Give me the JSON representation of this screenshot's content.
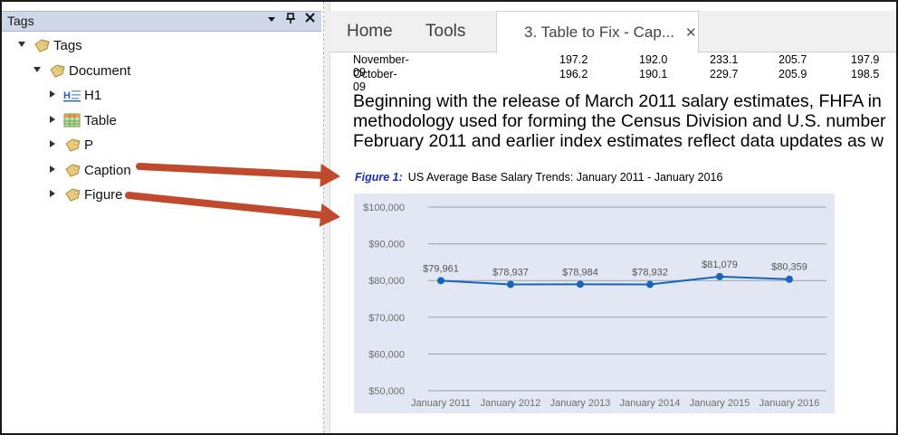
{
  "tags_panel": {
    "title": "Tags",
    "buttons": {
      "menu": "▾",
      "pin": "📌",
      "close": "✕"
    },
    "tree": [
      {
        "label": "Tags",
        "level": 0,
        "expanded": true,
        "icon": "tag-icon"
      },
      {
        "label": "Document",
        "level": 1,
        "expanded": true,
        "icon": "tag-icon"
      },
      {
        "label": "H1",
        "level": 2,
        "expanded": false,
        "icon": "heading-icon"
      },
      {
        "label": "Table",
        "level": 2,
        "expanded": false,
        "icon": "table-icon"
      },
      {
        "label": "P",
        "level": 2,
        "expanded": false,
        "icon": "tag-icon"
      },
      {
        "label": "Caption",
        "level": 2,
        "expanded": false,
        "icon": "tag-icon"
      },
      {
        "label": "Figure",
        "level": 2,
        "expanded": false,
        "icon": "tag-icon"
      }
    ]
  },
  "tabs": {
    "home": "Home",
    "tools": "Tools",
    "document": "3. Table to Fix - Cap...",
    "close": "✕"
  },
  "table_rows": [
    {
      "label": "November-09",
      "values": [
        "197.2",
        "192.0",
        "233.1",
        "205.7",
        "197.9"
      ]
    },
    {
      "label": "October-09",
      "values": [
        "196.2",
        "190.1",
        "229.7",
        "205.9",
        "198.5"
      ]
    }
  ],
  "paragraph": [
    "Beginning with the release of March 2011 salary estimates, FHFA in",
    "methodology used for forming the Census Division and U.S. number",
    "February 2011 and earlier index estimates reflect data updates as w"
  ],
  "caption": {
    "figure_label": "Figure 1:",
    "text": "US Average Base Salary Trends: January 2011 - January 2016"
  },
  "chart_data": {
    "type": "line",
    "categories": [
      "January 2011",
      "January 2012",
      "January 2013",
      "January 2014",
      "January 2015",
      "January 2016"
    ],
    "series": [
      {
        "values": [
          79961,
          78937,
          78984,
          78932,
          81079,
          80359
        ]
      }
    ],
    "data_labels": [
      "$79,961",
      "$78,937",
      "$78,984",
      "$78,932",
      "$81,079",
      "$80,359"
    ],
    "y_ticks": [
      "$100,000",
      "$90,000",
      "$80,000",
      "$70,000",
      "$60,000",
      "$50,000"
    ],
    "ylim": [
      50000,
      100000
    ],
    "grid": true,
    "colors": {
      "line": "#1565b8",
      "background": "#e3e6f3",
      "grid": "#9aa0ad"
    }
  },
  "colors": {
    "arrow": "#bf4a2e",
    "tags_header": "#cfd8e8"
  }
}
